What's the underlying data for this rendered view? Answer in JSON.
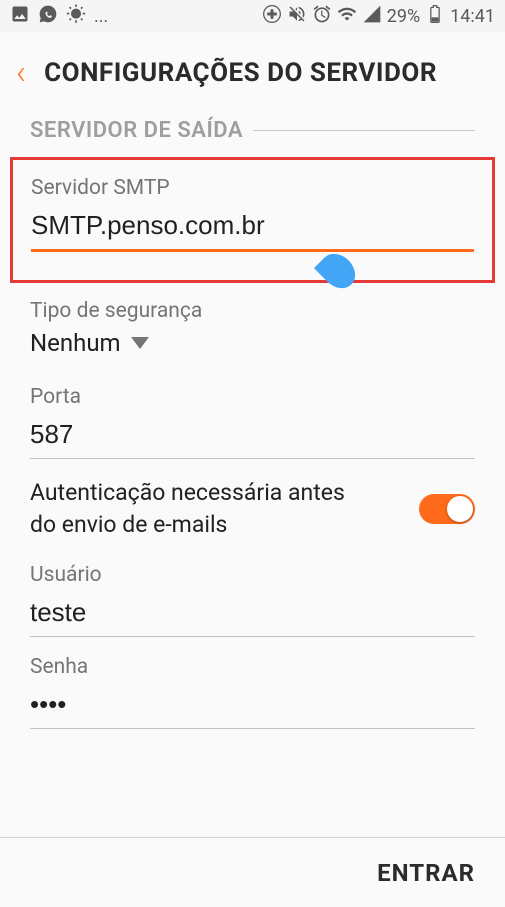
{
  "status_bar": {
    "battery_percent": "29%",
    "time": "14:41",
    "ellipsis": "..."
  },
  "header": {
    "title": "CONFIGURAÇÕES DO SERVIDOR"
  },
  "section": {
    "title": "SERVIDOR DE SAÍDA"
  },
  "smtp": {
    "label": "Servidor SMTP",
    "value": "SMTP.penso.com.br"
  },
  "security": {
    "label": "Tipo de segurança",
    "value": "Nenhum"
  },
  "port": {
    "label": "Porta",
    "value": "587"
  },
  "auth": {
    "label": "Autenticação necessária antes do envio de e-mails",
    "enabled": true
  },
  "user": {
    "label": "Usuário",
    "value": "teste"
  },
  "password": {
    "label": "Senha",
    "value": "••••"
  },
  "footer": {
    "enter": "ENTRAR"
  }
}
